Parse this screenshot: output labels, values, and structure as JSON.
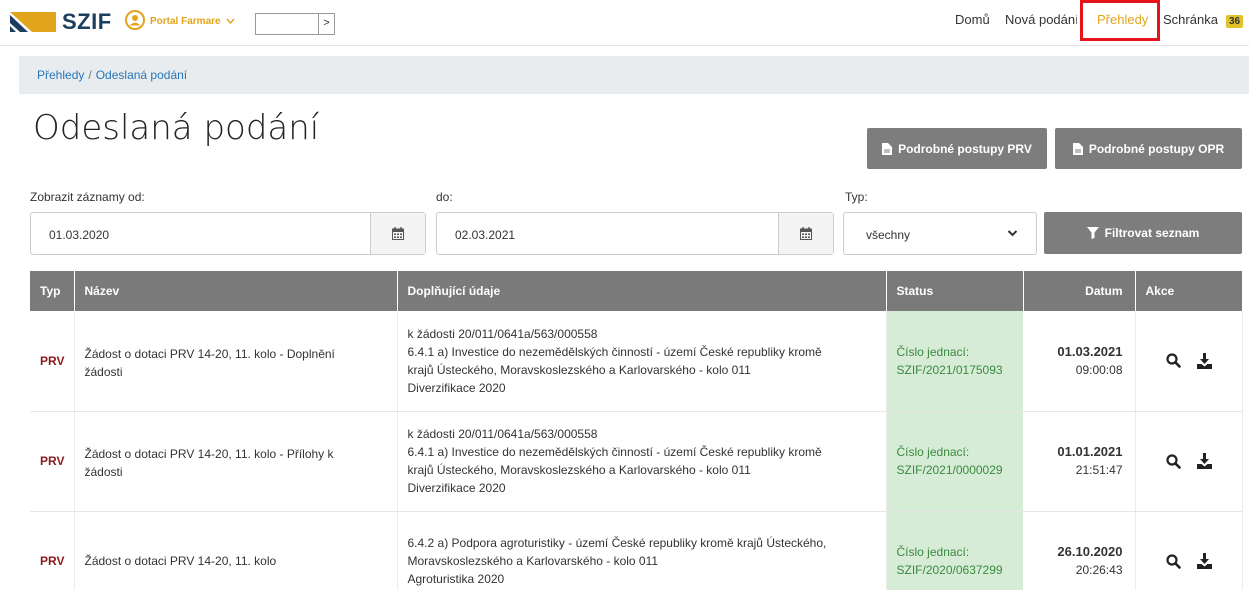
{
  "header": {
    "logo_text": "SZIF",
    "portal_label": "Portal Farmare",
    "top_input_value": "",
    "top_input_button": ">",
    "nav": [
      {
        "label": "Domů"
      },
      {
        "label": "Nová podání"
      },
      {
        "label": "Přehledy"
      },
      {
        "label": "Schránka"
      }
    ],
    "inbox_count": "36",
    "colors": {
      "brand_yellow": "#e2a41c",
      "highlight": "#e5141a"
    }
  },
  "breadcrumb": {
    "root": "Přehledy",
    "current": "Odeslaná podání"
  },
  "page_title": "Odeslaná podání",
  "buttons": {
    "prv": "Podrobné postupy PRV",
    "opr": "Podrobné postupy OPR",
    "filter": "Filtrovat seznam"
  },
  "filter": {
    "from_label": "Zobrazit záznamy od:",
    "from_value": "01.03.2020",
    "to_label": "do:",
    "to_value": "02.03.2021",
    "type_label": "Typ:",
    "type_value": "všechny"
  },
  "table": {
    "columns": [
      "Typ",
      "Název",
      "Doplňující údaje",
      "Status",
      "Datum",
      "Akce"
    ],
    "rows": [
      {
        "typ": "PRV",
        "nazev": [
          "Žádost o dotaci PRV 14-20, 11. kolo - Doplnění",
          "žádosti"
        ],
        "detail": [
          "k žádosti 20/011/0641a/563/000558",
          "6.4.1 a) Investice do nezemědělských činností - území České republiky kromě",
          "krajů Ústeckého, Moravskoslezského a Karlovarského - kolo 011",
          "Diverzifikace 2020"
        ],
        "status_label": "Číslo jednací:",
        "status_value": "SZIF/2021/0175093",
        "date": "01.03.2021",
        "time": "09:00:08"
      },
      {
        "typ": "PRV",
        "nazev": [
          "Žádost o dotaci PRV 14-20, 11. kolo - Přílohy k",
          "žádosti"
        ],
        "detail": [
          "k žádosti 20/011/0641a/563/000558",
          "6.4.1 a) Investice do nezemědělských činností - území České republiky kromě",
          "krajů Ústeckého, Moravskoslezského a Karlovarského - kolo 011",
          "Diverzifikace 2020"
        ],
        "status_label": "Číslo jednací:",
        "status_value": "SZIF/2021/0000029",
        "date": "01.01.2021",
        "time": "21:51:47"
      },
      {
        "typ": "PRV",
        "nazev": [
          "Žádost o dotaci PRV 14-20, 11. kolo",
          ""
        ],
        "detail": [
          "6.4.2 a) Podpora agroturistiky - území České republiky kromě krajů Ústeckého,",
          "Moravskoslezského a Karlovarského - kolo 011",
          "Agroturistika 2020",
          ""
        ],
        "status_label": "Číslo jednací:",
        "status_value": "SZIF/2020/0637299",
        "date": "26.10.2020",
        "time": "20:26:43"
      }
    ]
  }
}
